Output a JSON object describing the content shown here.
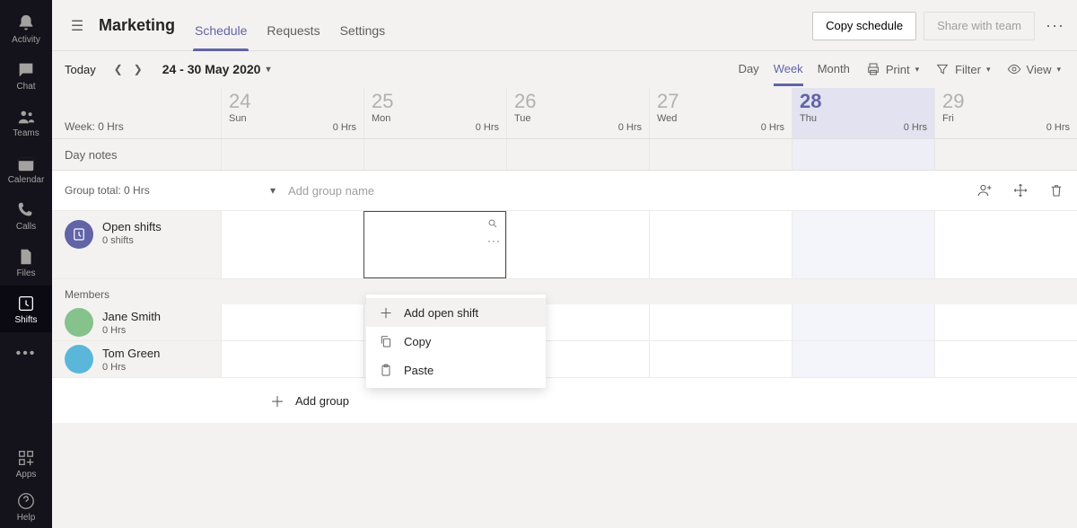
{
  "app_rail": {
    "items": [
      {
        "id": "activity",
        "label": "Activity"
      },
      {
        "id": "chat",
        "label": "Chat"
      },
      {
        "id": "teams",
        "label": "Teams"
      },
      {
        "id": "calendar",
        "label": "Calendar"
      },
      {
        "id": "calls",
        "label": "Calls"
      },
      {
        "id": "files",
        "label": "Files"
      },
      {
        "id": "shifts",
        "label": "Shifts",
        "active": true
      }
    ],
    "bottom": [
      {
        "id": "apps",
        "label": "Apps"
      },
      {
        "id": "help",
        "label": "Help"
      }
    ]
  },
  "header": {
    "team": "Marketing",
    "tabs": {
      "schedule": "Schedule",
      "requests": "Requests",
      "settings": "Settings"
    },
    "copy_btn": "Copy schedule",
    "share_btn": "Share with team"
  },
  "datebar": {
    "today": "Today",
    "range": "24 - 30 May 2020",
    "views": {
      "day": "Day",
      "week": "Week",
      "month": "Month"
    },
    "print": "Print",
    "filter": "Filter",
    "view": "View"
  },
  "left": {
    "week_total": "Week: 0 Hrs",
    "day_notes": "Day notes",
    "group_total": "Group total: 0 Hrs",
    "open_shifts": {
      "title": "Open shifts",
      "sub": "0 shifts"
    },
    "members_label": "Members",
    "members": [
      {
        "name": "Jane Smith",
        "hrs": "0 Hrs",
        "color": "green"
      },
      {
        "name": "Tom Green",
        "hrs": "0 Hrs",
        "color": "blue"
      }
    ]
  },
  "group_header": {
    "placeholder": "Add group name"
  },
  "days": [
    {
      "num": "24",
      "dow": "Sun",
      "hrs": "0 Hrs",
      "today": false
    },
    {
      "num": "25",
      "dow": "Mon",
      "hrs": "0 Hrs",
      "today": false
    },
    {
      "num": "26",
      "dow": "Tue",
      "hrs": "0 Hrs",
      "today": false
    },
    {
      "num": "27",
      "dow": "Wed",
      "hrs": "0 Hrs",
      "today": false
    },
    {
      "num": "28",
      "dow": "Thu",
      "hrs": "0 Hrs",
      "today": true
    },
    {
      "num": "29",
      "dow": "Fri",
      "hrs": "0 Hrs",
      "today": false
    }
  ],
  "add_group": "Add group",
  "context_menu": {
    "add_open_shift": "Add open shift",
    "copy": "Copy",
    "paste": "Paste"
  }
}
